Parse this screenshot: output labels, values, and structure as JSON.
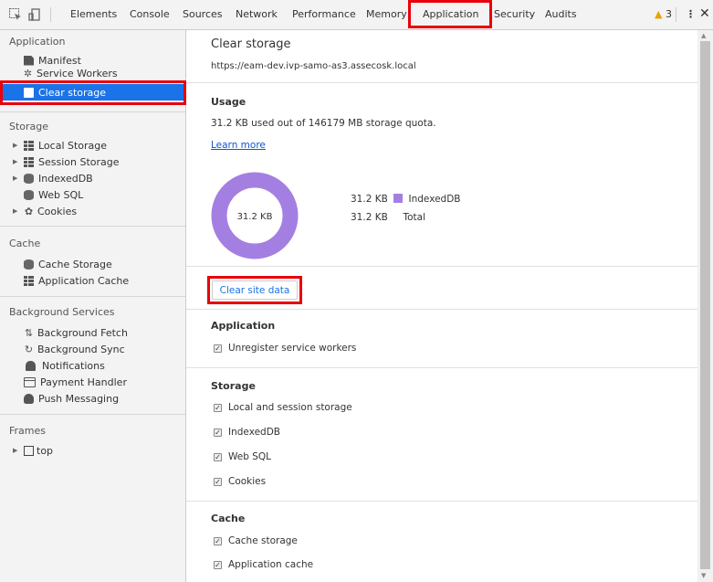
{
  "toolbar": {
    "tabs": [
      "Elements",
      "Console",
      "Sources",
      "Network",
      "Performance",
      "Memory",
      "Application",
      "Security",
      "Audits"
    ],
    "warning_count": "3",
    "icons": [
      "inspect-icon",
      "device-toggle-icon",
      "warning-icon",
      "more-menu-icon",
      "close-icon"
    ]
  },
  "sidebar": {
    "application": {
      "title": "Application",
      "items": [
        "Manifest",
        "Service Workers",
        "Clear storage"
      ]
    },
    "storage": {
      "title": "Storage",
      "items": [
        "Local Storage",
        "Session Storage",
        "IndexedDB",
        "Web SQL",
        "Cookies"
      ]
    },
    "cache": {
      "title": "Cache",
      "items": [
        "Cache Storage",
        "Application Cache"
      ]
    },
    "background": {
      "title": "Background Services",
      "items": [
        "Background Fetch",
        "Background Sync",
        "Notifications",
        "Payment Handler",
        "Push Messaging"
      ]
    },
    "frames": {
      "title": "Frames",
      "items": [
        "top"
      ]
    }
  },
  "main": {
    "title": "Clear storage",
    "url": "https://eam-dev.ivp-samo-as3.assecosk.local",
    "usage": {
      "heading": "Usage",
      "summary": "31.2 KB used out of 146179 MB storage quota.",
      "learn_more": "Learn more",
      "donut_label": "31.2 KB",
      "legend": [
        {
          "value": "31.2 KB",
          "label": "IndexedDB",
          "color": "#a47fe2"
        },
        {
          "value": "31.2 KB",
          "label": "Total"
        }
      ]
    },
    "clear_button": "Clear site data",
    "application": {
      "heading": "Application",
      "options": [
        "Unregister service workers"
      ]
    },
    "storage": {
      "heading": "Storage",
      "options": [
        "Local and session storage",
        "IndexedDB",
        "Web SQL",
        "Cookies"
      ]
    },
    "cache": {
      "heading": "Cache",
      "options": [
        "Cache storage",
        "Application cache"
      ]
    }
  },
  "colors": {
    "accent": "#1a73e8",
    "highlight_border": "#e8000b",
    "donut": "#a47fe2"
  }
}
